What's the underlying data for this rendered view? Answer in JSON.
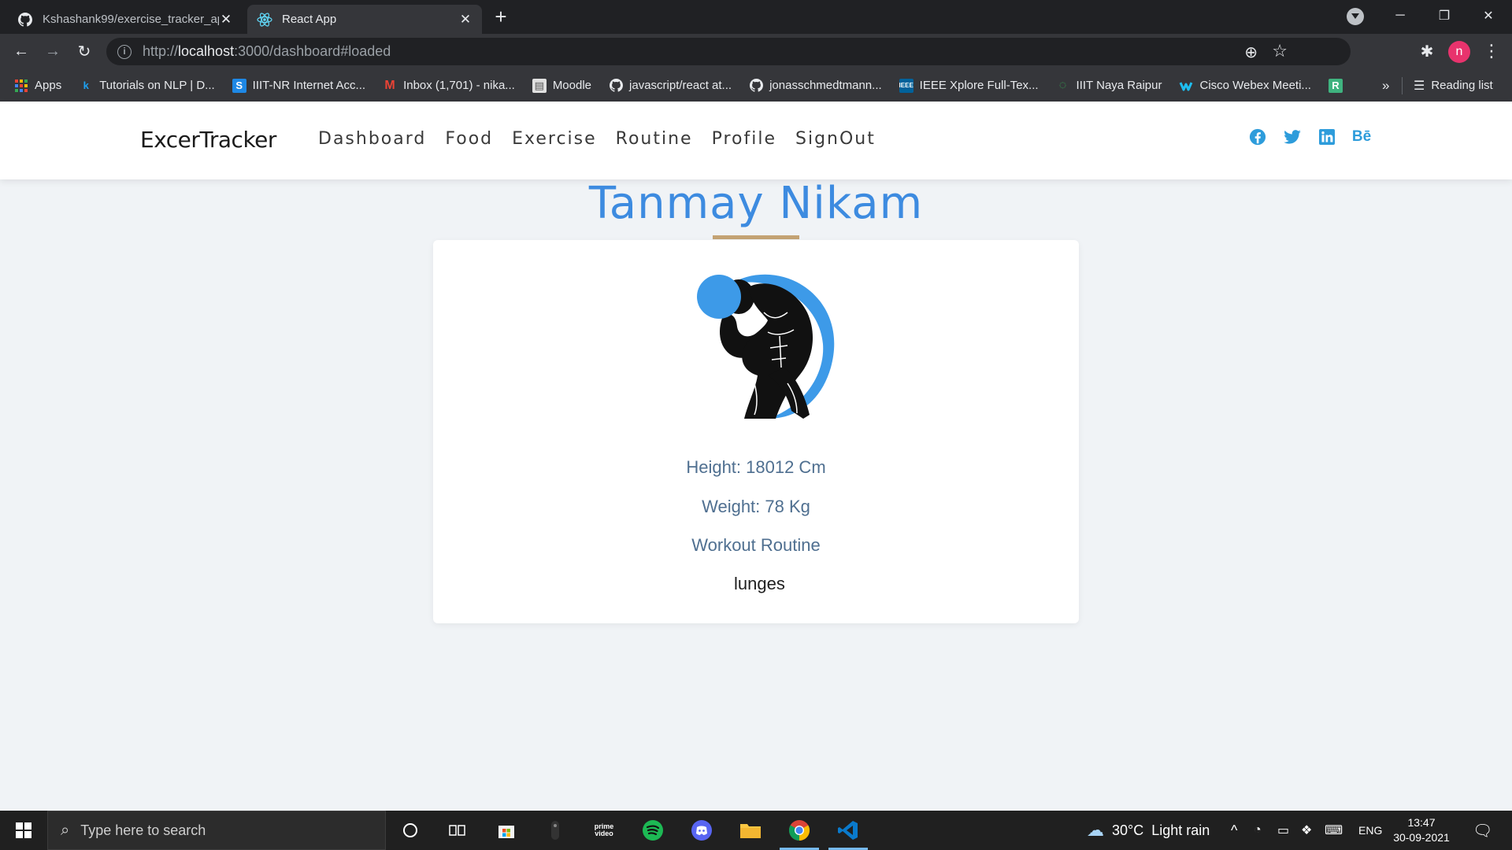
{
  "browser": {
    "tabs": [
      {
        "title": "Kshashank99/exercise_tracker_ap",
        "icon": "github-icon"
      },
      {
        "title": "React App",
        "icon": "react-icon"
      }
    ],
    "url": {
      "prefix": "http://",
      "host": "localhost",
      "rest": ":3000/dashboard#loaded"
    },
    "profile_initial": "n",
    "bookmarks": [
      {
        "label": "Apps",
        "icon": "apps-grid-icon"
      },
      {
        "label": "Tutorials on NLP | D...",
        "icon": "k-icon"
      },
      {
        "label": "IIIT-NR Internet Acc...",
        "icon": "s-icon"
      },
      {
        "label": "Inbox (1,701) - nika...",
        "icon": "gmail-icon"
      },
      {
        "label": "Moodle",
        "icon": "moodle-icon"
      },
      {
        "label": "javascript/react at...",
        "icon": "github-icon"
      },
      {
        "label": "jonasschmedtmann...",
        "icon": "github-icon"
      },
      {
        "label": "IEEE Xplore Full-Tex...",
        "icon": "ieee-icon"
      },
      {
        "label": "IIIT Naya Raipur",
        "icon": "iiit-icon"
      },
      {
        "label": "Cisco Webex Meeti...",
        "icon": "webex-icon"
      },
      {
        "label": "",
        "icon": "r-icon"
      }
    ],
    "more_bookmarks": "»",
    "reading_list": "Reading list"
  },
  "app": {
    "brand": "ExcerTracker",
    "nav": [
      "Dashboard",
      "Food",
      "Exercise",
      "Routine",
      "Profile",
      "SignOut"
    ],
    "social_icons": [
      "facebook-icon",
      "twitter-icon",
      "linkedin-icon",
      "behance-icon"
    ],
    "behance_text": "Bē",
    "colors": {
      "accent": "#3d8be0",
      "underline": "#c4a374",
      "info_text": "#4f6f90",
      "social": "#2d9cdb"
    }
  },
  "profile": {
    "name": "Tanmay Nikam",
    "height": "Height: 18012 Cm",
    "weight": "Weight: 78 Kg",
    "routine_label": "Workout Routine",
    "routine_items": [
      "lunges"
    ]
  },
  "taskbar": {
    "search_placeholder": "Type here to search",
    "weather": "30°C  Light rain",
    "language": "ENG",
    "time": "13:47",
    "date": "30-09-2021"
  }
}
